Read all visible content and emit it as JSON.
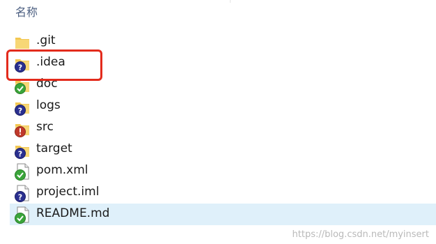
{
  "header": {
    "column_label": "名称"
  },
  "files": [
    {
      "name": ".git",
      "kind": "folder",
      "badge": "none"
    },
    {
      "name": ".idea",
      "kind": "folder",
      "badge": "question"
    },
    {
      "name": "doc",
      "kind": "folder",
      "badge": "ok"
    },
    {
      "name": "logs",
      "kind": "folder",
      "badge": "question"
    },
    {
      "name": "src",
      "kind": "folder",
      "badge": "error"
    },
    {
      "name": "target",
      "kind": "folder",
      "badge": "question"
    },
    {
      "name": "pom.xml",
      "kind": "file",
      "badge": "ok"
    },
    {
      "name": "project.iml",
      "kind": "file",
      "badge": "question"
    },
    {
      "name": "README.md",
      "kind": "file",
      "badge": "ok",
      "selected": true
    }
  ],
  "watermark": "https://blog.csdn.net/myinsert",
  "colors": {
    "folder": "#f3c751",
    "question_badge": "#2a2f8f",
    "ok_badge": "#3aa53a",
    "error_badge": "#c0392b",
    "highlight_box": "#e32b1c",
    "selected_row": "#dff0fa"
  }
}
